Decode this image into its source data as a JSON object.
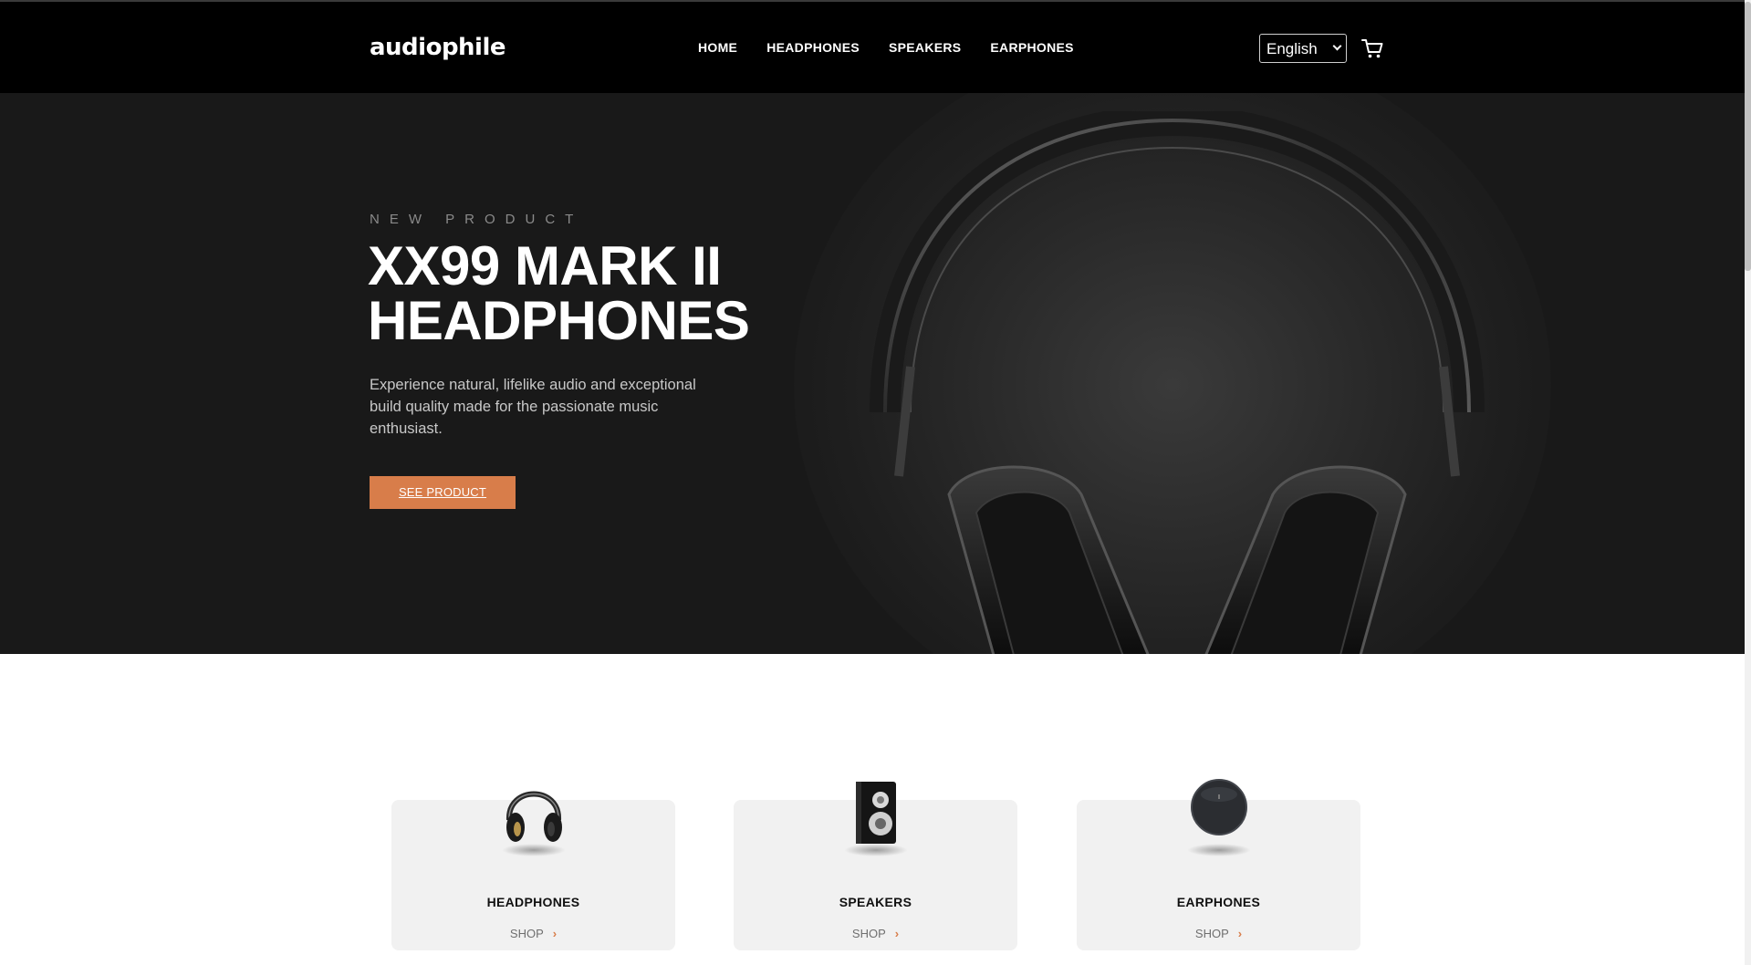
{
  "header": {
    "logo": "audiophile",
    "nav": [
      "HOME",
      "HEADPHONES",
      "SPEAKERS",
      "EARPHONES"
    ],
    "language": "English",
    "cart_icon": "cart-icon"
  },
  "hero": {
    "eyebrow": "NEW PRODUCT",
    "title_line1": "XX99 MARK II",
    "title_line2": "HEADPHONES",
    "description": "Experience natural, lifelike audio and exceptional build quality made for the passionate music enthusiast.",
    "cta": "SEE PRODUCT"
  },
  "categories": [
    {
      "name": "HEADPHONES",
      "shop": "SHOP"
    },
    {
      "name": "SPEAKERS",
      "shop": "SHOP"
    },
    {
      "name": "EARPHONES",
      "shop": "SHOP"
    }
  ],
  "colors": {
    "accent": "#d87d4a",
    "header_bg": "#000000",
    "hero_bg": "#191919",
    "card_bg": "#f1f1f1"
  }
}
